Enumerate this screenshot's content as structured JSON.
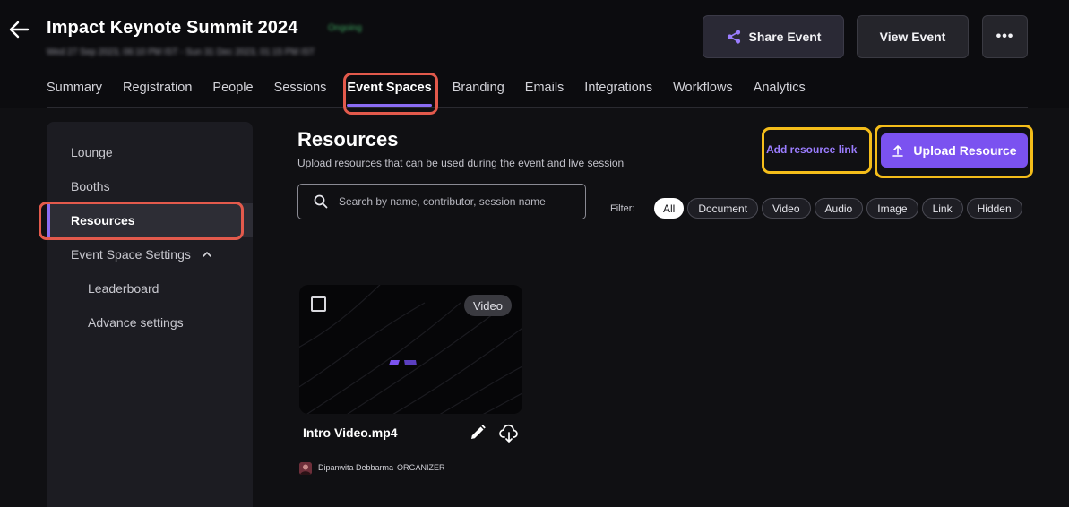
{
  "header": {
    "title": "Impact Keynote Summit 2024",
    "status": "Ongoing",
    "dates": "Wed 27 Sep 2023, 06:10 PM IST - Sun 31 Dec 2023, 01:15 PM IST",
    "share_label": "Share Event",
    "view_label": "View Event",
    "more_label": "•••"
  },
  "nav": {
    "tabs": [
      {
        "label": "Summary"
      },
      {
        "label": "Registration"
      },
      {
        "label": "People"
      },
      {
        "label": "Sessions"
      },
      {
        "label": "Event Spaces",
        "active": true
      },
      {
        "label": "Branding"
      },
      {
        "label": "Emails"
      },
      {
        "label": "Integrations"
      },
      {
        "label": "Workflows"
      },
      {
        "label": "Analytics"
      }
    ]
  },
  "sidebar": {
    "items": [
      {
        "label": "Lounge"
      },
      {
        "label": "Booths"
      },
      {
        "label": "Resources",
        "active": true
      },
      {
        "label": "Event Space Settings"
      },
      {
        "label": "Leaderboard"
      },
      {
        "label": "Advance settings"
      }
    ]
  },
  "main": {
    "title": "Resources",
    "subtitle": "Upload resources that can be used during the event and live session",
    "add_link_label": "Add resource link",
    "upload_label": "Upload Resource",
    "search_placeholder": "Search by name, contributor, session name",
    "filter_label": "Filter:",
    "filters": [
      {
        "label": "All",
        "active": true
      },
      {
        "label": "Document"
      },
      {
        "label": "Video"
      },
      {
        "label": "Audio"
      },
      {
        "label": "Image"
      },
      {
        "label": "Link"
      },
      {
        "label": "Hidden"
      }
    ]
  },
  "resource": {
    "name": "Intro Video.mp4",
    "type": "Video",
    "author": "Dipanwita Debbarma",
    "role": "ORGANIZER"
  },
  "colors": {
    "accent": "#7b52f0",
    "highlight_red": "#e35a4c",
    "highlight_yellow": "#f4bd1a"
  }
}
